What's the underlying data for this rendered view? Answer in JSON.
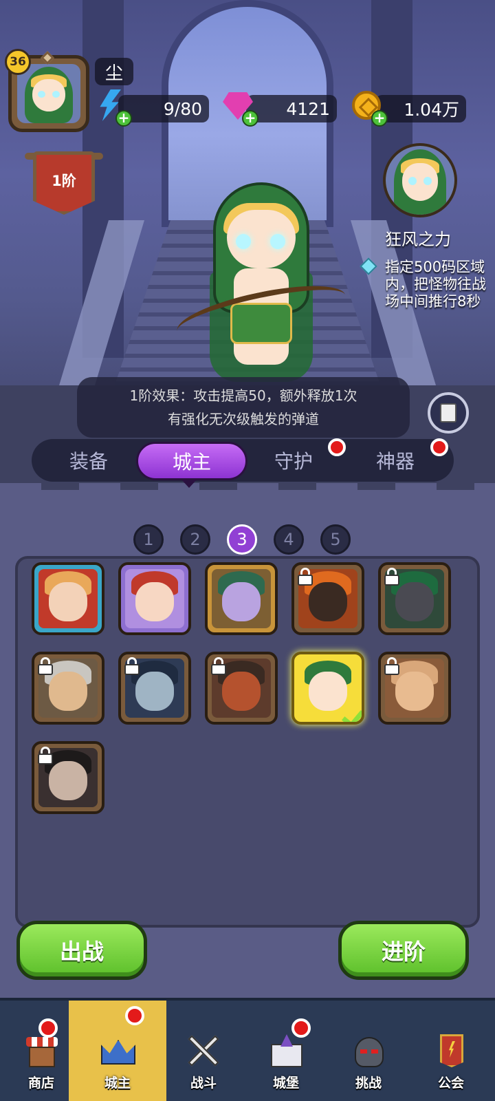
{
  "player": {
    "level": "36",
    "name": "尘",
    "rank": "1阶"
  },
  "resources": {
    "energy": "9/80",
    "gems": "4121",
    "gold": "1.04万"
  },
  "skill": {
    "name": "狂风之力",
    "description": "指定500码区域内，把怪物往战场中间推行8秒"
  },
  "effect": {
    "line1": "1阶效果：攻击提高50，额外释放1次",
    "line2": "有强化无次级触发的弹道"
  },
  "tabs": [
    {
      "label": "装备",
      "active": false,
      "badge": false
    },
    {
      "label": "城主",
      "active": true,
      "badge": false
    },
    {
      "label": "守护",
      "active": false,
      "badge": true
    },
    {
      "label": "神器",
      "active": false,
      "badge": true
    }
  ],
  "pages": [
    "1",
    "2",
    "3",
    "4",
    "5"
  ],
  "active_page": "3",
  "heroes": [
    {
      "locked": false,
      "frame": "blue",
      "selected": false
    },
    {
      "locked": false,
      "frame": "purple",
      "selected": false
    },
    {
      "locked": false,
      "frame": "gold",
      "selected": false
    },
    {
      "locked": true,
      "frame": "brown",
      "selected": false
    },
    {
      "locked": true,
      "frame": "brown",
      "selected": false
    },
    {
      "locked": true,
      "frame": "brown",
      "selected": false
    },
    {
      "locked": true,
      "frame": "brown",
      "selected": false
    },
    {
      "locked": true,
      "frame": "brown",
      "selected": false
    },
    {
      "locked": false,
      "frame": "selected",
      "selected": true
    },
    {
      "locked": true,
      "frame": "brown",
      "selected": false
    },
    {
      "locked": true,
      "frame": "brown",
      "selected": false
    }
  ],
  "actions": {
    "deploy": "出战",
    "advance": "进阶"
  },
  "nav": [
    {
      "label": "商店",
      "icon": "shop-icon",
      "badge": true,
      "active": false
    },
    {
      "label": "城主",
      "icon": "crown-icon",
      "badge": true,
      "active": true
    },
    {
      "label": "战斗",
      "icon": "crossed-swords-icon",
      "badge": false,
      "active": false
    },
    {
      "label": "城堡",
      "icon": "castle-icon",
      "badge": true,
      "active": false
    },
    {
      "label": "挑战",
      "icon": "demon-helmet-icon",
      "badge": false,
      "active": false
    },
    {
      "label": "公会",
      "icon": "guild-banner-icon",
      "badge": false,
      "active": false
    }
  ],
  "colors": {
    "accent_purple": "#9140d4",
    "button_green": "#5cbf2a",
    "badge_red": "#e31a1a",
    "nav_active": "#e8c14a"
  }
}
